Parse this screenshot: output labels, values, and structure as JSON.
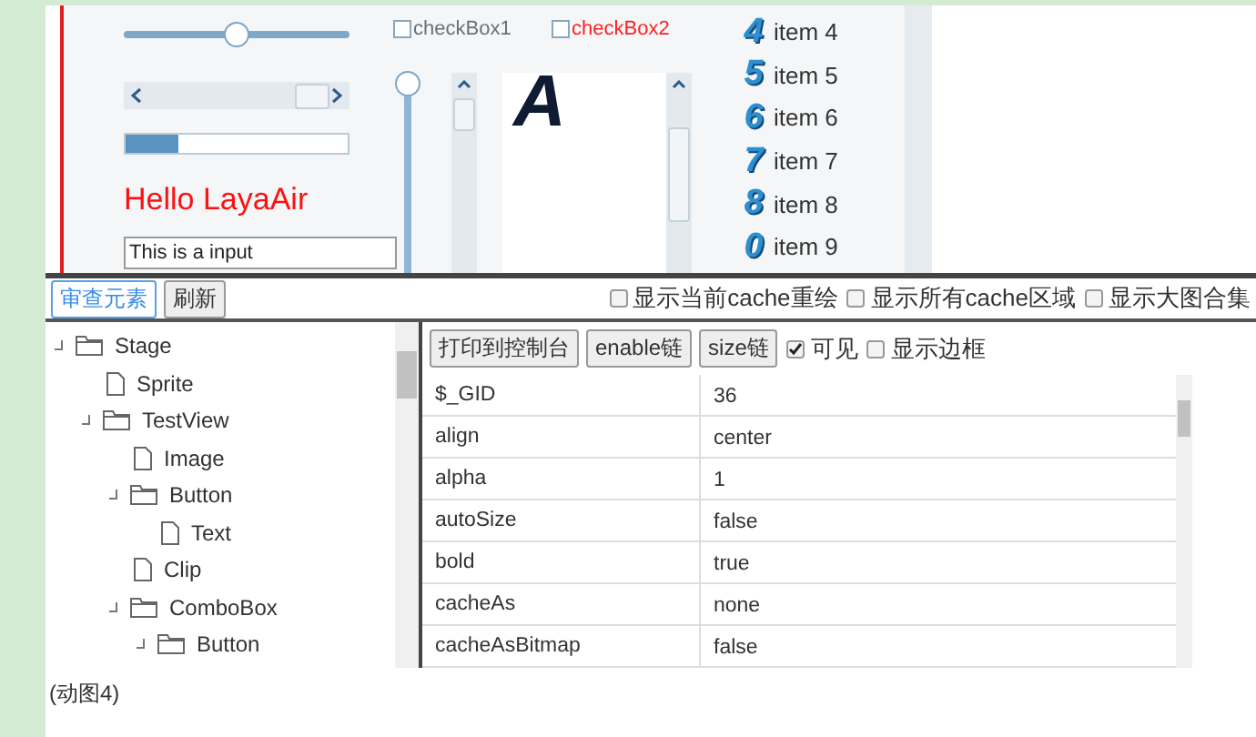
{
  "stage": {
    "slider": {
      "level": 0.5
    },
    "progress": {
      "level": 0.24
    },
    "label": "Hello LayaAir",
    "input": {
      "value": "This is a input"
    },
    "checkboxes": [
      {
        "label": "checkBox1",
        "checked": false,
        "color": "#6a7078"
      },
      {
        "label": "checkBox2",
        "checked": false,
        "color": "#ff2020"
      }
    ],
    "vslider": {
      "level": 0
    },
    "text_area": {
      "text": "A"
    },
    "list": [
      {
        "digit": "4",
        "label": "item 4"
      },
      {
        "digit": "5",
        "label": "item 5"
      },
      {
        "digit": "6",
        "label": "item 6"
      },
      {
        "digit": "7",
        "label": "item 7"
      },
      {
        "digit": "8",
        "label": "item 8"
      },
      {
        "digit": "0",
        "label": "item 9"
      }
    ]
  },
  "toolbar": {
    "buttons": [
      {
        "label": "审查元素",
        "selected": true
      },
      {
        "label": "刷新",
        "selected": false
      }
    ],
    "checkboxes": [
      {
        "label": "显示当前cache重绘",
        "checked": false
      },
      {
        "label": "显示所有cache区域",
        "checked": false
      },
      {
        "label": "显示大图合集",
        "checked": false
      }
    ]
  },
  "tree": [
    {
      "label": "Stage",
      "expanded": true,
      "children": [
        {
          "label": "Sprite"
        },
        {
          "label": "TestView",
          "expanded": true,
          "children": [
            {
              "label": "Image"
            },
            {
              "label": "Button",
              "expanded": true,
              "children": [
                {
                  "label": "Text"
                }
              ]
            },
            {
              "label": "Clip"
            },
            {
              "label": "ComboBox",
              "expanded": true,
              "children": [
                {
                  "label": "Button",
                  "expanded": true
                }
              ]
            }
          ]
        }
      ]
    }
  ],
  "properties": {
    "buttons": [
      "打印到控制台",
      "enable链",
      "size链"
    ],
    "checkboxes": [
      {
        "label": "可见",
        "checked": true
      },
      {
        "label": "显示边框",
        "checked": false
      }
    ],
    "rows": [
      {
        "name": "$_GID",
        "value": "36"
      },
      {
        "name": "align",
        "value": "center"
      },
      {
        "name": "alpha",
        "value": "1"
      },
      {
        "name": "autoSize",
        "value": "false"
      },
      {
        "name": "bold",
        "value": "true"
      },
      {
        "name": "cacheAs",
        "value": "none"
      },
      {
        "name": "cacheAsBitmap",
        "value": "false"
      }
    ]
  },
  "caption": "(动图4)"
}
